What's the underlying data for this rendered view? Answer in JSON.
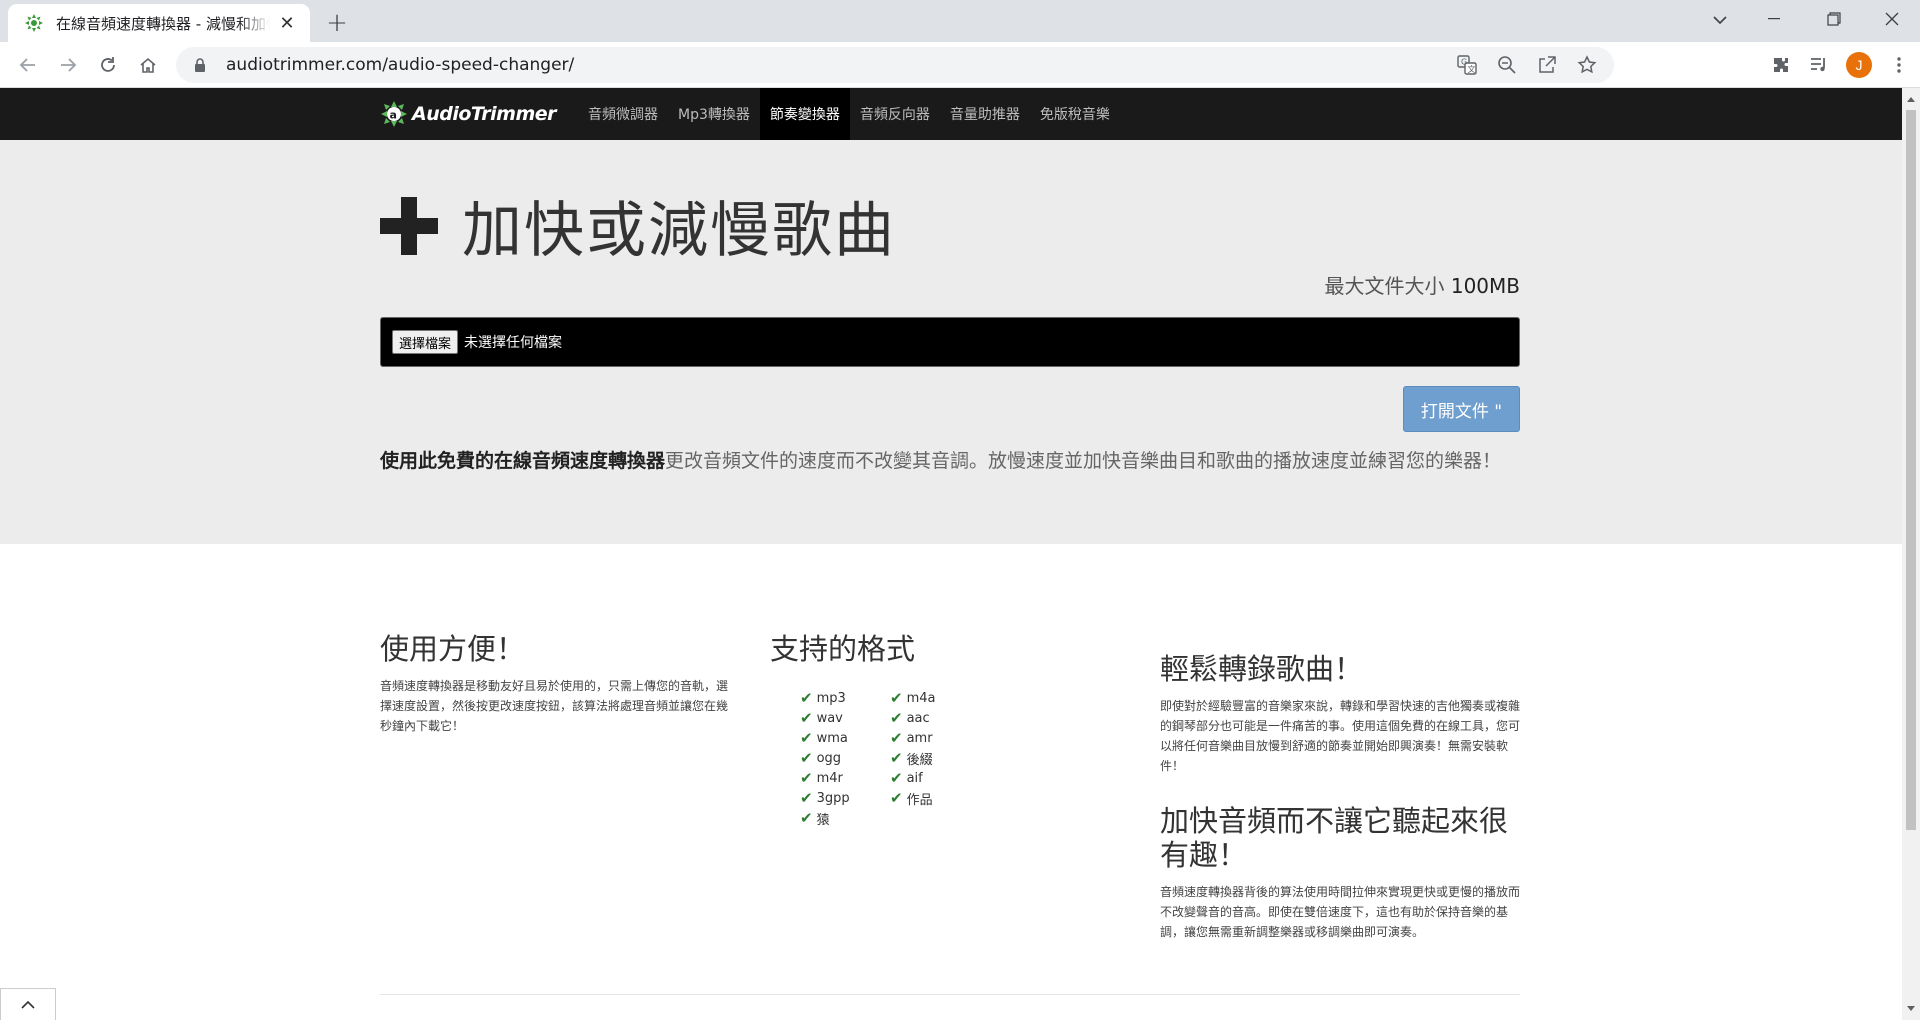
{
  "browser": {
    "tab_title": "在線音頻速度轉換器 - 減慢和加快",
    "url": "audiotrimmer.com/audio-speed-changer/",
    "avatar_letter": "J"
  },
  "site": {
    "logo_text": "AudioTrimmer",
    "nav": [
      {
        "label": "音頻微調器"
      },
      {
        "label": "Mp3轉換器"
      },
      {
        "label": "節奏變換器"
      },
      {
        "label": "音頻反向器"
      },
      {
        "label": "音量助推器"
      },
      {
        "label": "免版稅音樂"
      }
    ],
    "active_nav_index": 2
  },
  "hero": {
    "title": "加快或減慢歌曲",
    "max_size_label": "最大文件大小",
    "max_size_value": "100MB",
    "file_button": "選擇檔案",
    "file_status": "未選擇任何檔案",
    "open_button": "打開文件 \"",
    "desc_bold": "使用此免費的在線音頻速度轉換器",
    "desc_rest": "更改音頻文件的速度而不改變其音調。放慢速度並加快音樂曲目和歌曲的播放速度並練習您的樂器！"
  },
  "features": {
    "easy": {
      "title": "使用方便！",
      "text": "音頻速度轉換器是移動友好且易於使用的，只需上傳您的音軌，選擇速度設置，然後按更改速度按鈕，該算法將處理音頻並讓您在幾秒鐘內下載它！"
    },
    "formats": {
      "title": "支持的格式",
      "items": [
        "mp3",
        "m4a",
        "wav",
        "aac",
        "wma",
        "amr",
        "ogg",
        "後綴",
        "m4r",
        "aif",
        "3gpp",
        "作品",
        "猿"
      ]
    },
    "transcribe": {
      "title": "輕鬆轉錄歌曲！",
      "text": "即使對於經驗豐富的音樂家來說，轉錄和學習快速的吉他獨奏或複雜的鋼琴部分也可能是一件痛苦的事。使用這個免費的在線工具，您可以將任何音樂曲目放慢到舒適的節奏並開始即興演奏！無需安裝軟件！"
    },
    "speedup": {
      "title": "加快音頻而不讓它聽起來很有趣！",
      "text": "音頻速度轉換器背後的算法使用時間拉伸來實現更快或更慢的播放而不改變聲音的音高。即使在雙倍速度下，這也有助於保持音樂的基調，讓您無需重新調整樂器或移調樂曲即可演奏。"
    }
  }
}
